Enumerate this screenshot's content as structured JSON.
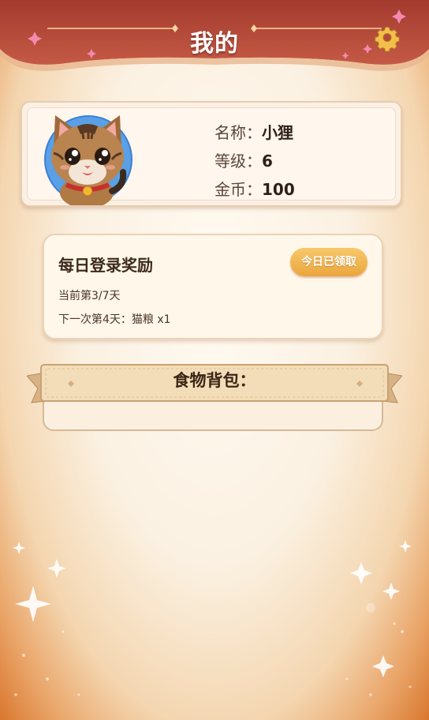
{
  "header": {
    "title": "我的",
    "settings_icon": "gear-icon"
  },
  "profile": {
    "avatar_icon": "cat-avatar",
    "name_label": "名称：",
    "name_value": "小狸",
    "level_label": "等级：",
    "level_value": "6",
    "coins_label": "金币：",
    "coins_value": "100"
  },
  "daily_reward": {
    "title": "每日登录奖励",
    "button_label": "今日已领取",
    "current": "当前第3/7天",
    "next": "下一次第4天：猫粮 x1"
  },
  "bag": {
    "title": "食物背包："
  },
  "colors": {
    "header": "#b14a3a",
    "accent_button": "#eaa63e",
    "text": "#3b2a1f"
  }
}
